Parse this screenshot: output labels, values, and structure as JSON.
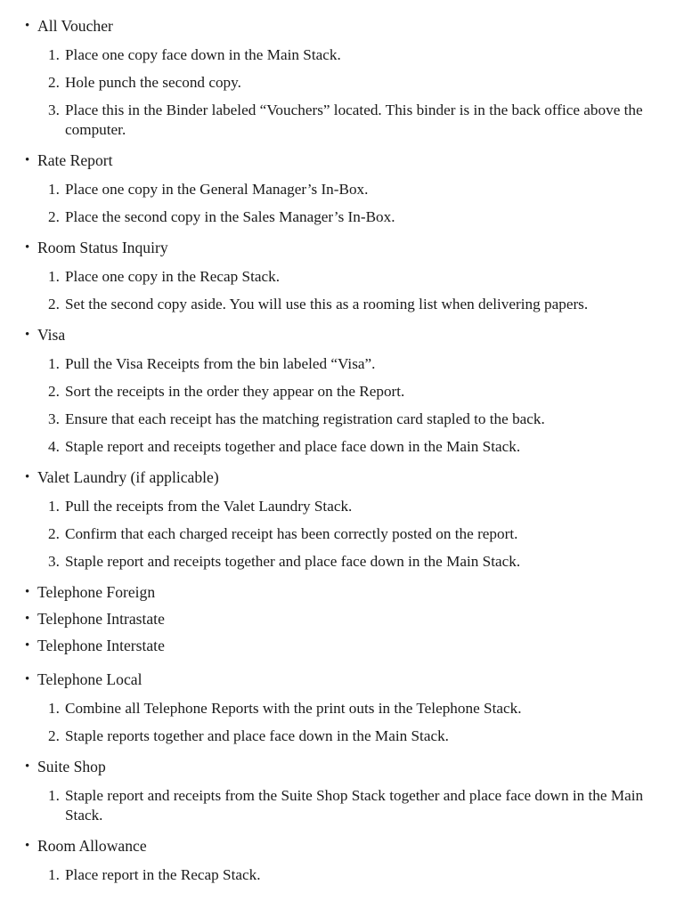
{
  "document": {
    "background_color": "#ffffff",
    "text_color": "#1a1a1a",
    "bullet_glyph": "•",
    "sections": [
      {
        "heading": "All Voucher",
        "steps": [
          "Place one copy face down in the Main Stack.",
          "Hole punch the second copy.",
          "Place this in the Binder labeled “Vouchers” located.  This binder is in the back office above the computer."
        ]
      },
      {
        "heading": "Rate Report",
        "steps": [
          "Place one copy in the General Manager’s In-Box.",
          "Place the second copy in the Sales Manager’s In-Box."
        ]
      },
      {
        "heading": "Room Status Inquiry",
        "steps": [
          "Place one copy in the Recap Stack.",
          "Set the second copy aside.  You will use this as a rooming list when delivering papers."
        ]
      },
      {
        "heading": "Visa",
        "steps": [
          "Pull the Visa Receipts from the bin labeled “Visa”.",
          "Sort the receipts in the order they appear on the Report.",
          "Ensure that each receipt has the matching registration card stapled to the back.",
          "Staple report and receipts together and place face down in the Main Stack."
        ]
      },
      {
        "heading": "Valet Laundry (if applicable)",
        "steps": [
          "Pull the receipts from the Valet Laundry Stack.",
          "Confirm that each charged receipt has been correctly posted on the report.",
          "Staple report and receipts together and place face down in the Main Stack."
        ]
      },
      {
        "heading": "Telephone Foreign",
        "steps": []
      },
      {
        "heading": "Telephone Intrastate",
        "steps": []
      },
      {
        "heading": "Telephone Interstate",
        "steps": []
      },
      {
        "heading": "Telephone Local",
        "steps": [
          "Combine all Telephone Reports with the print outs in the Telephone Stack.",
          "Staple reports together and place face down in the Main Stack."
        ]
      },
      {
        "heading": "Suite Shop",
        "steps": [
          "Staple report and receipts from the Suite Shop Stack together and place face down in the Main Stack."
        ]
      },
      {
        "heading": "Room Allowance",
        "steps": [
          "Place report in the Recap Stack."
        ]
      }
    ]
  }
}
